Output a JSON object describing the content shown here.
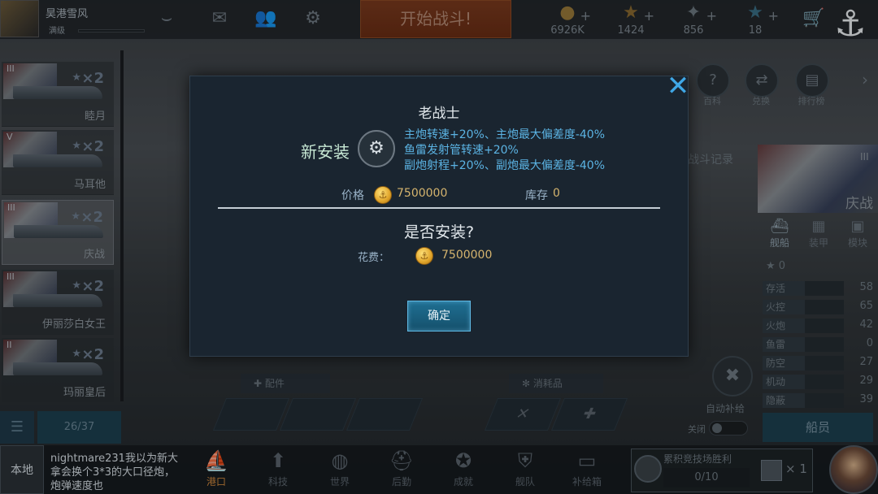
{
  "topbar": {
    "player_name": "昊港雪风",
    "player_rank": "满级",
    "start_battle": "开始战斗!",
    "resources": [
      {
        "icon": "gold-coin-icon",
        "value": "6926K"
      },
      {
        "icon": "star-icon",
        "value": "1424"
      },
      {
        "icon": "eagle-icon",
        "value": "856"
      },
      {
        "icon": "star-badge-icon",
        "value": "18"
      }
    ]
  },
  "ship_list": {
    "ships": [
      {
        "tier": "III",
        "count": "×2",
        "name": "睦月"
      },
      {
        "tier": "V",
        "count": "×2",
        "name": "马耳他"
      },
      {
        "tier": "III",
        "count": "×2",
        "name": "庆战"
      },
      {
        "tier": "III",
        "count": "×2",
        "name": "伊丽莎白女王"
      },
      {
        "tier": "II",
        "count": "×2",
        "name": "玛丽皇后"
      }
    ],
    "page_count": "26/37"
  },
  "right_panel": {
    "ship_name": "庆战",
    "ship_tier": "III",
    "battle_record": "战斗记录",
    "circle_buttons": [
      {
        "label": "百科",
        "icon": "question-icon"
      },
      {
        "label": "兑换",
        "icon": "exchange-icon"
      },
      {
        "label": "排行榜",
        "icon": "leaderboard-icon"
      }
    ],
    "tabs": [
      {
        "label": "舰船"
      },
      {
        "label": "装甲"
      },
      {
        "label": "模块"
      }
    ],
    "star_count": "0",
    "stats": [
      {
        "label": "存活",
        "value": "58"
      },
      {
        "label": "火控",
        "value": "65"
      },
      {
        "label": "火炮",
        "value": "42"
      },
      {
        "label": "鱼雷",
        "value": "0"
      },
      {
        "label": "防空",
        "value": "27"
      },
      {
        "label": "机动",
        "value": "29"
      },
      {
        "label": "隐蔽",
        "value": "39"
      }
    ],
    "auto_supply": "自动补给",
    "auto_supply_state": "关闭",
    "crew_button": "船员"
  },
  "center": {
    "parts_tab": "配件",
    "consumables_tab": "消耗品"
  },
  "bottom_nav": {
    "local_tab": "本地",
    "chat_message": "nightmare231我以为新大拿会换个3*3的大口径炮，炮弹速度也",
    "items": [
      {
        "label": "港口",
        "icon": "harbor-icon",
        "active": true
      },
      {
        "label": "科技",
        "icon": "tech-icon",
        "active": false
      },
      {
        "label": "世界",
        "icon": "globe-icon",
        "active": false
      },
      {
        "label": "后勤",
        "icon": "logistics-icon",
        "active": false
      },
      {
        "label": "成就",
        "icon": "achievement-icon",
        "active": false
      },
      {
        "label": "舰队",
        "icon": "fleet-icon",
        "active": false
      },
      {
        "label": "补给箱",
        "icon": "supply-box-icon",
        "active": false
      }
    ],
    "arena": {
      "title": "累积竞技场胜利",
      "progress": "0/10",
      "multiplier": "× 1"
    }
  },
  "dialog": {
    "title": "老战士",
    "new_install": "新安装",
    "effects": [
      "主炮转速+20%、主炮最大偏差度-40%",
      "鱼雷发射管转速+20%",
      "副炮射程+20%、副炮最大偏差度-40%"
    ],
    "price_label": "价格",
    "price_value": "7500000",
    "stock_label": "库存",
    "stock_value": "0",
    "confirm_question": "是否安装?",
    "cost_label": "花费：",
    "cost_value": "7500000",
    "ok_button": "确定",
    "accent_color": "#3fa7e6",
    "effect_color": "#5bb3e3",
    "price_color": "#d5b46e"
  }
}
